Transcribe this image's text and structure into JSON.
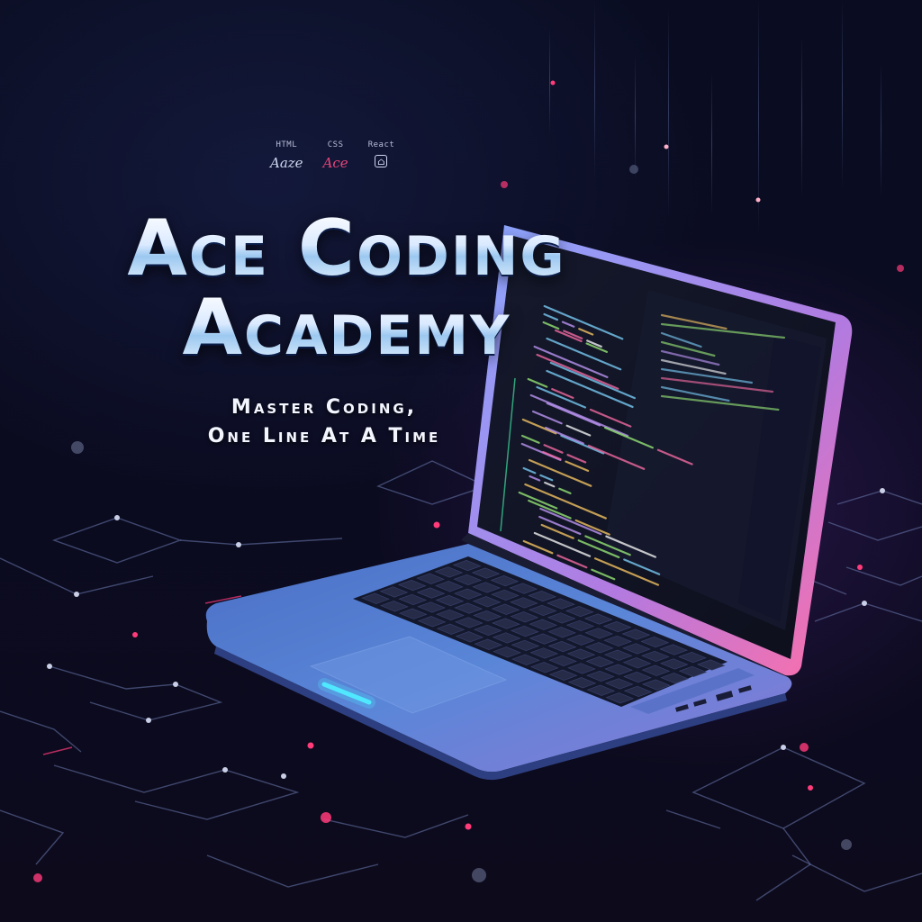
{
  "tech_stack": [
    {
      "name": "HTML",
      "logo": "Aaze"
    },
    {
      "name": "CSS",
      "logo": "Ace"
    },
    {
      "name": "React",
      "logo": "⌂"
    }
  ],
  "headline": {
    "line1": "Ace Coding",
    "line2": "Academy"
  },
  "tagline": {
    "line1": "Master Coding,",
    "line2": "One Line At A Time"
  },
  "colors": {
    "background": "#0a0d22",
    "accent_pink": "#ff3b7a",
    "accent_cyan": "#4fe8ff",
    "laptop_body": "#5a86d8"
  },
  "icons": [
    "laptop-icon",
    "circuit-lines"
  ]
}
